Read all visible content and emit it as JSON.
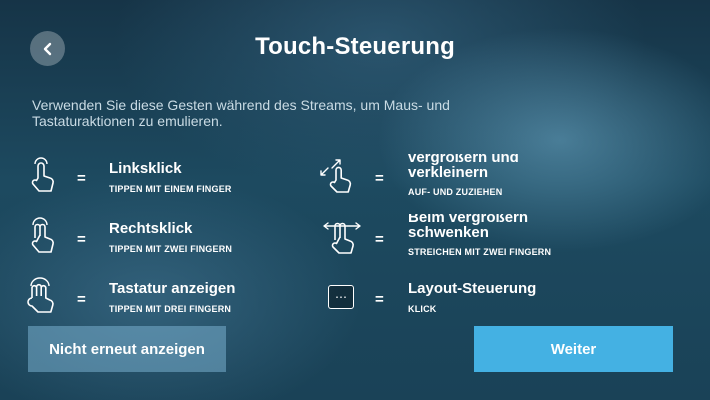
{
  "header": {
    "title": "Touch-Steuerung",
    "back_icon": "chevron-left-icon"
  },
  "description": "Verwenden Sie diese Gesten während des Streams, um Maus- und Tastaturaktionen zu emulieren.",
  "equals": "=",
  "gestures": [
    {
      "label": "Linksklick",
      "sub": "TIPPEN MIT EINEM FINGER",
      "icon": "one-finger-tap-icon"
    },
    {
      "label": "Rechtsklick",
      "sub": "TIPPEN MIT ZWEI FINGERN",
      "icon": "two-finger-tap-icon"
    },
    {
      "label": "Tastatur anzeigen",
      "sub": "TIPPEN MIT DREI FINGERN",
      "icon": "three-finger-tap-icon"
    },
    {
      "label": "vergrößern und verkleinern",
      "sub": "AUF- UND ZUZIEHEN",
      "icon": "pinch-zoom-icon"
    },
    {
      "label": "Beim vergrößern schwenken",
      "sub": "STREICHEN MIT ZWEI FINGERN",
      "icon": "two-finger-pan-icon"
    },
    {
      "label": "Layout-Steuerung",
      "sub": "KLICK",
      "icon": "layout-menu-icon",
      "icon_glyph": "⋯"
    }
  ],
  "buttons": {
    "dont_show": "Nicht erneut anzeigen",
    "next": "Weiter"
  }
}
